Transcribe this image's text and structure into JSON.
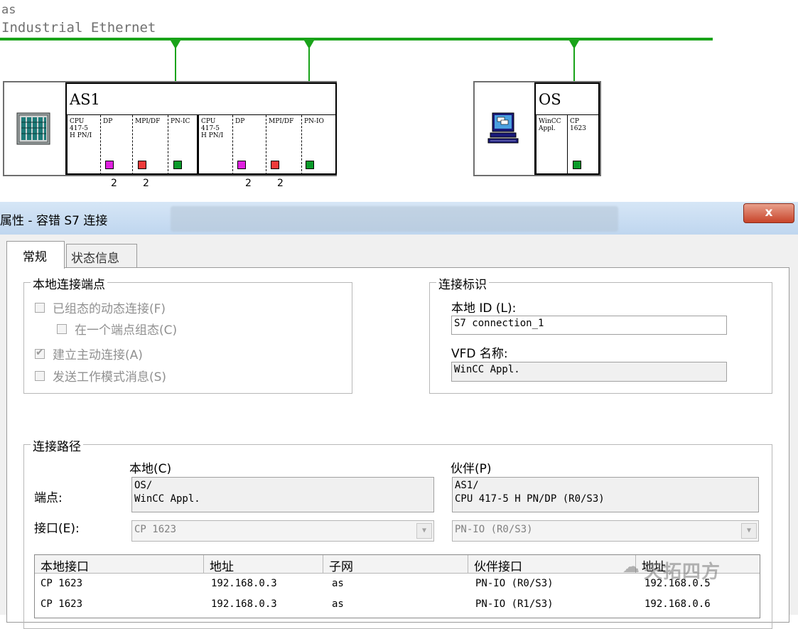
{
  "network": {
    "name": "as",
    "type": "Industrial Ethernet"
  },
  "stations": {
    "as1": {
      "name": "AS1",
      "slots_a": [
        {
          "label": "CPU\n417-5\nH PN/I"
        },
        {
          "label": "DP",
          "port": "dp"
        },
        {
          "label": "MPI/DF",
          "port": "mpi"
        },
        {
          "label": "PN-IC",
          "port": "pn"
        }
      ],
      "slots_b": [
        {
          "label": "CPU\n417-5\nH PN/I"
        },
        {
          "label": "DP",
          "port": "dp"
        },
        {
          "label": "MPI/DF",
          "port": "mpi"
        },
        {
          "label": "PN-IO",
          "port": "pn"
        }
      ],
      "subnet_numbers": [
        "2",
        "2",
        "2",
        "2"
      ]
    },
    "os": {
      "name": "OS",
      "slots": [
        {
          "label": "WinCC\nAppl."
        },
        {
          "label": "CP\n1623",
          "port": "pn"
        }
      ]
    }
  },
  "dialog": {
    "title": "属性 - 容错 S7 连接",
    "close_glyph": "x",
    "tabs": [
      {
        "label": "常规",
        "active": true
      },
      {
        "label": "状态信息",
        "active": false
      }
    ],
    "local_endpoint": {
      "title": "本地连接端点",
      "options": [
        {
          "label": "已组态的动态连接(F)",
          "checked": false
        },
        {
          "label": "在一个端点组态(C)",
          "checked": false
        },
        {
          "label": "建立主动连接(A)",
          "checked": true
        },
        {
          "label": "发送工作模式消息(S)",
          "checked": false
        }
      ]
    },
    "connection_id": {
      "title": "连接标识",
      "local_id_label": "本地 ID (L):",
      "local_id_value": "S7 connection_1",
      "vfd_label": "VFD 名称:",
      "vfd_value": "WinCC Appl."
    },
    "connection_path": {
      "title": "连接路径",
      "local_header": "本地(C)",
      "partner_header": "伙伴(P)",
      "endpoint_label": "端点:",
      "local_endpoint": [
        "OS/",
        "WinCC Appl."
      ],
      "partner_endpoint": [
        "AS1/",
        "CPU 417-5 H PN/DP (R0/S3)"
      ],
      "interface_label": "接口(E):",
      "local_interface": "CP 1623",
      "partner_interface": "PN-IO (R0/S3)"
    },
    "table": {
      "columns": [
        "本地接口",
        "地址",
        "子网",
        "伙伴接口",
        "地址"
      ],
      "rows": [
        [
          "CP 1623",
          "192.168.0.3",
          "as",
          "PN-IO (R0/S3)",
          "192.168.0.5"
        ],
        [
          "CP 1623",
          "192.168.0.3",
          "as",
          "PN-IO (R1/S3)",
          "192.168.0.6"
        ]
      ]
    },
    "watermark": "天拓四方"
  },
  "colors": {
    "bus": "#19a319",
    "dp_port": "#e020e0",
    "mpi_port": "#f03a3a",
    "pn_port": "#0a9a2a"
  }
}
